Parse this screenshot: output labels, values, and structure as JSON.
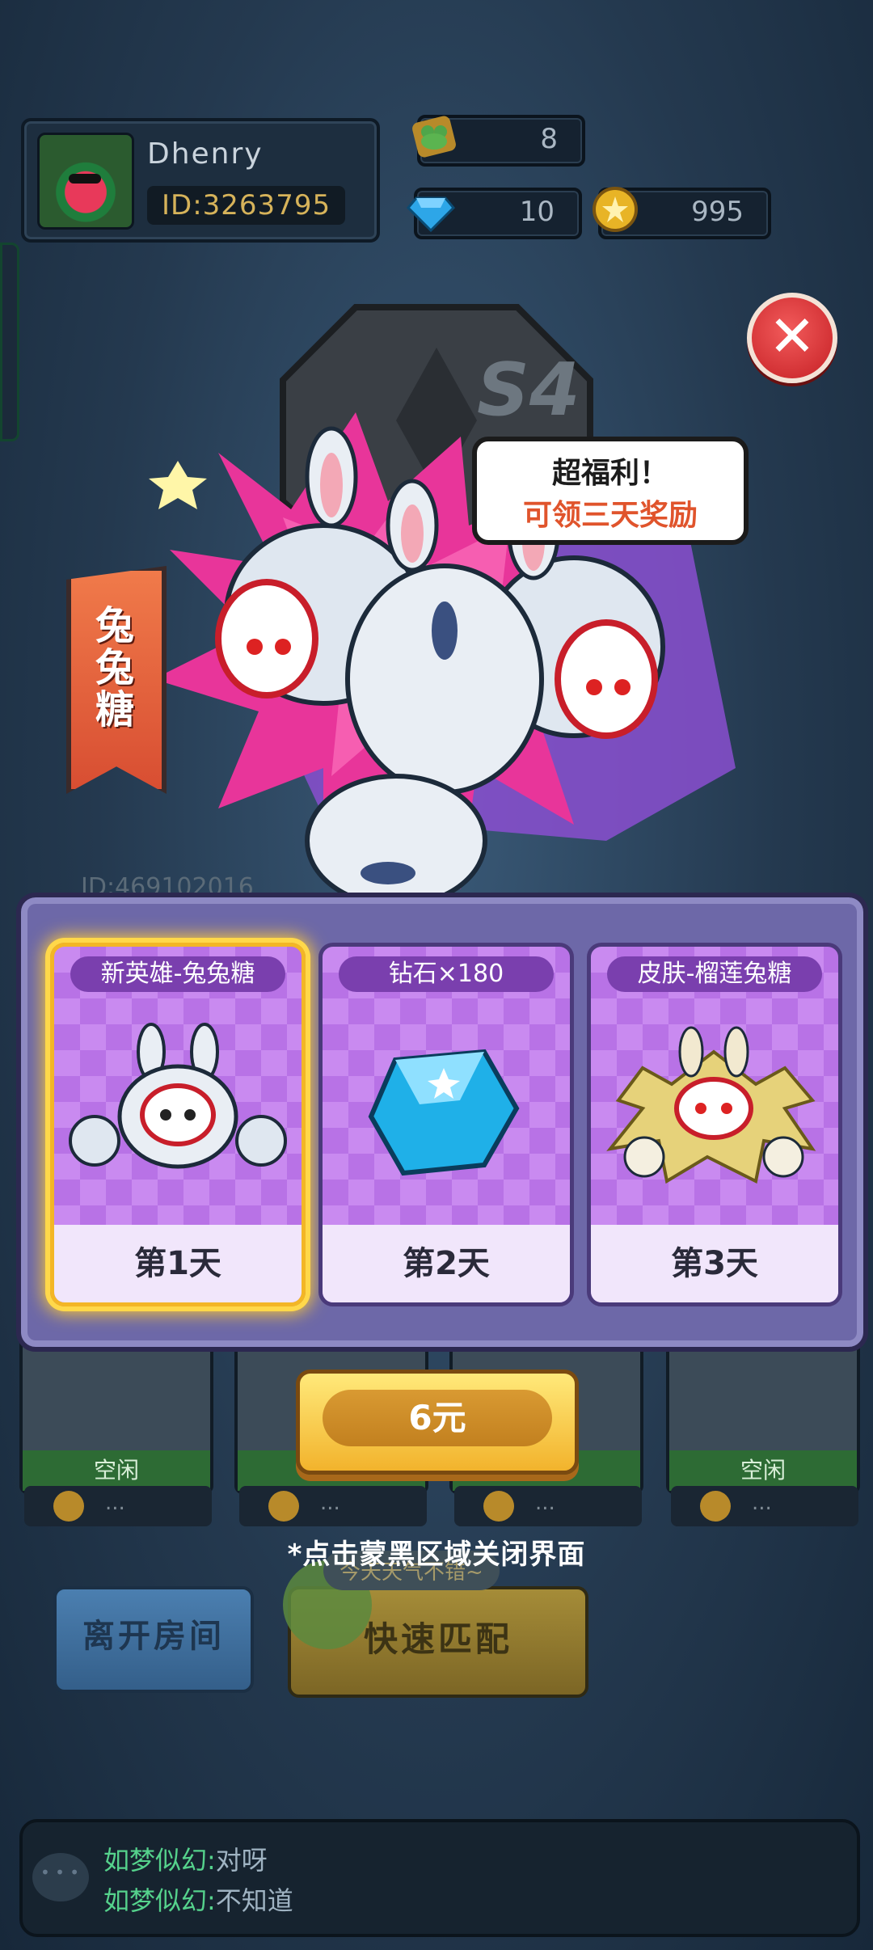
{
  "player": {
    "name": "Dhenry",
    "id": "ID:3263795"
  },
  "resources": {
    "frog_tickets": "8",
    "diamonds": "10",
    "coins": "995"
  },
  "season": {
    "badge": "S4"
  },
  "popup": {
    "speech_line1": "超福利！",
    "speech_line2": "可领三天奖励",
    "hero_banner": "兔兔糖",
    "rewards": [
      {
        "title": "新英雄-兔兔糖",
        "day": "第1天",
        "selected": true
      },
      {
        "title": "钻石×180",
        "day": "第2天",
        "selected": false
      },
      {
        "title": "皮肤-榴莲兔糖",
        "day": "第3天",
        "selected": false
      }
    ],
    "price_label": "6元",
    "close_hint": "*点击蒙黑区域关闭界面"
  },
  "room": {
    "slot_status": [
      "空闲",
      "",
      "",
      "空闲"
    ],
    "slot_footer": "...",
    "leave_label": "离开房间",
    "match_label": "快速匹配",
    "mascot_bubble": "今天天气不错~",
    "obscured_id": "ID:469102016"
  },
  "chat": [
    {
      "user": "如梦似幻:",
      "text": "对呀"
    },
    {
      "user": "如梦似幻:",
      "text": "不知道"
    }
  ],
  "colors": {
    "accent_gold": "#ffcc33",
    "panel_purple": "#6d68a8",
    "close_red": "#d32a2f"
  }
}
